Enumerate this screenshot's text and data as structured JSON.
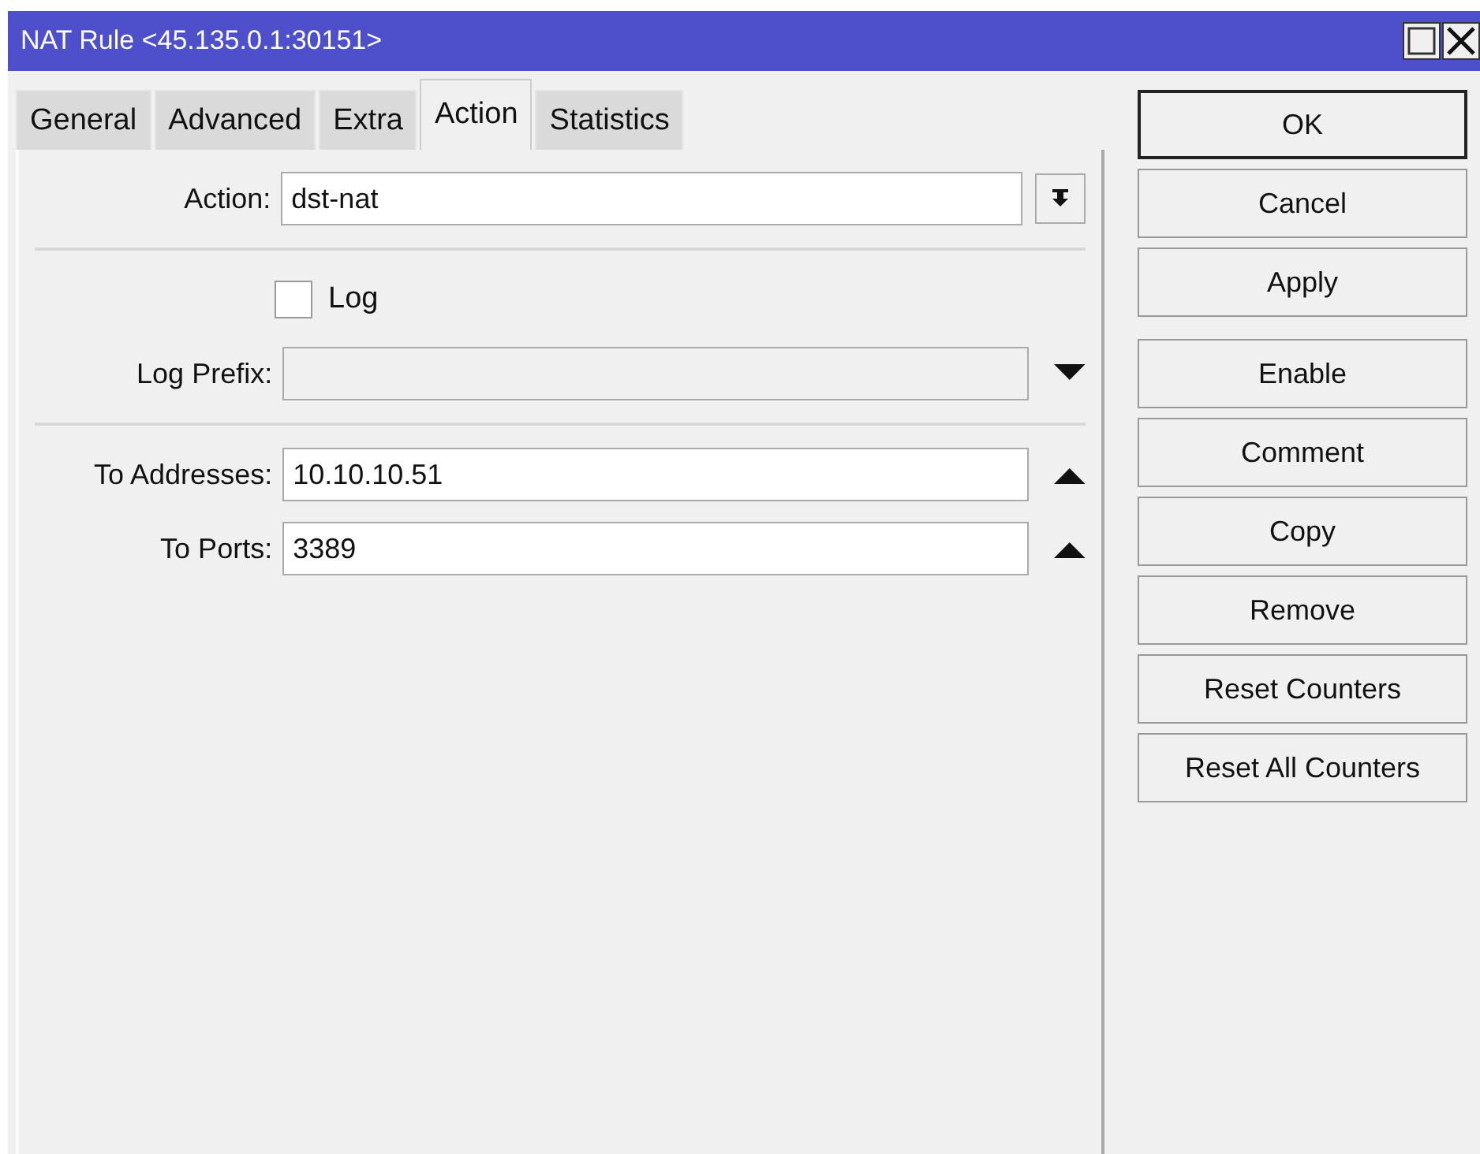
{
  "window": {
    "title": "NAT Rule <45.135.0.1:30151>"
  },
  "tabs": [
    {
      "label": "General",
      "selected": false
    },
    {
      "label": "Advanced",
      "selected": false
    },
    {
      "label": "Extra",
      "selected": false
    },
    {
      "label": "Action",
      "selected": true
    },
    {
      "label": "Statistics",
      "selected": false
    }
  ],
  "sections": [
    {
      "fields": [
        {
          "kind": "select",
          "label": "Action:",
          "value": "dst-nat"
        }
      ]
    },
    {
      "fields": [
        {
          "kind": "checkbox",
          "label": "Log",
          "checked": false
        },
        {
          "kind": "collapsed",
          "label": "Log Prefix:",
          "disabled": true
        }
      ]
    },
    {
      "fields": [
        {
          "kind": "expanded",
          "label": "To Addresses:",
          "value": "10.10.10.51",
          "disabled": false
        },
        {
          "kind": "expanded",
          "label": "To Ports:",
          "value": "3389",
          "disabled": false
        }
      ]
    }
  ],
  "button_groups": [
    {
      "buttons": [
        {
          "label": "OK",
          "default": true
        },
        {
          "label": "Cancel",
          "default": false
        },
        {
          "label": "Apply",
          "default": false
        }
      ]
    },
    {
      "buttons": [
        {
          "label": "Enable",
          "default": false
        },
        {
          "label": "Comment",
          "default": false
        },
        {
          "label": "Copy",
          "default": false
        },
        {
          "label": "Remove",
          "default": false
        },
        {
          "label": "Reset Counters",
          "default": false
        },
        {
          "label": "Reset All Counters",
          "default": false
        }
      ]
    }
  ]
}
